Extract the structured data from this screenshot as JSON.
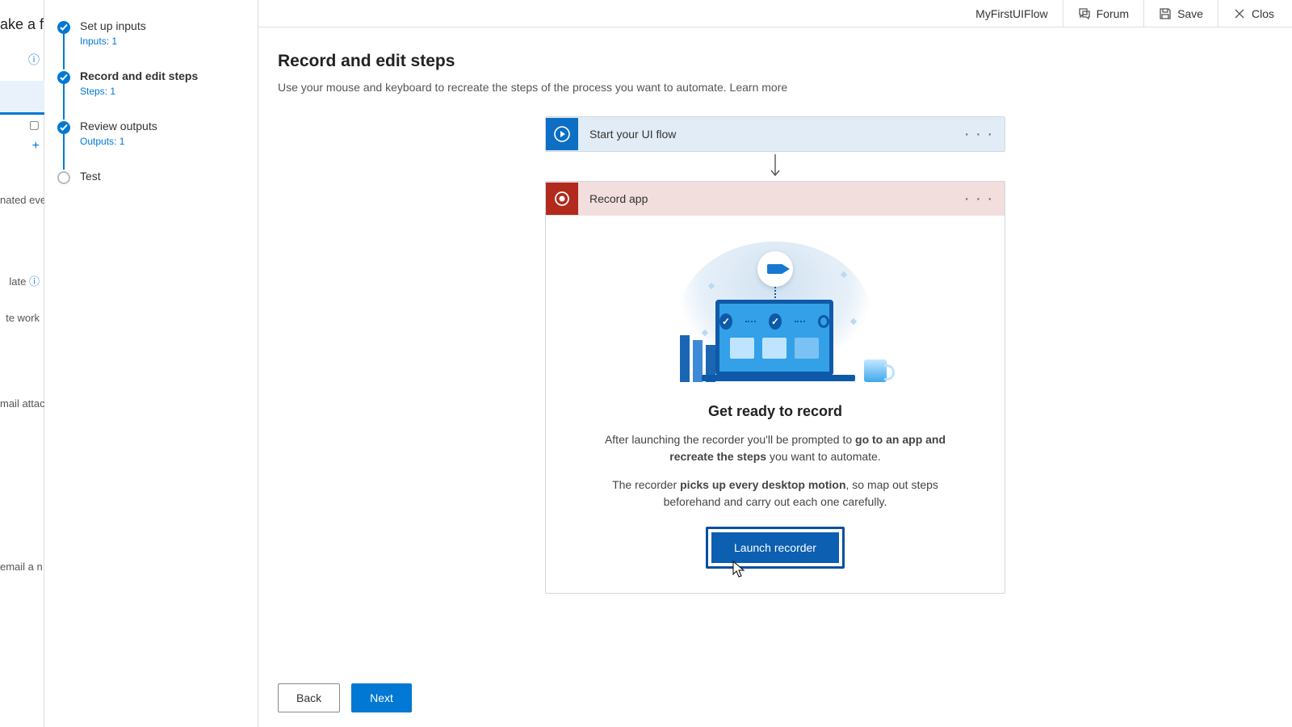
{
  "leftcol": {
    "title_frag": "ake a fl",
    "frag1": "nated even",
    "frag2": "late",
    "frag3": "te work",
    "frag4": "mail attac",
    "frag5": "email a n"
  },
  "steps": [
    {
      "label": "Set up inputs",
      "sub": "Inputs: 1",
      "done": true,
      "active": false
    },
    {
      "label": "Record and edit steps",
      "sub": "Steps: 1",
      "done": true,
      "active": true
    },
    {
      "label": "Review outputs",
      "sub": "Outputs: 1",
      "done": true,
      "active": false
    },
    {
      "label": "Test",
      "sub": "",
      "done": false,
      "active": false
    }
  ],
  "topbar": {
    "flow_name": "MyFirstUIFlow",
    "forum": "Forum",
    "save": "Save",
    "close": "Clos"
  },
  "page": {
    "heading": "Record and edit steps",
    "desc_text": "Use your mouse and keyboard to recreate the steps of the process you want to automate.  ",
    "learn_more": "Learn more"
  },
  "cards": {
    "start_title": "Start your UI flow",
    "record_title": "Record app"
  },
  "record_panel": {
    "heading": "Get ready to record",
    "p1_pre": "After launching the recorder you'll be prompted to ",
    "p1_bold": "go to an app and recreate the steps",
    "p1_post": " you want to automate.",
    "p2_pre": "The recorder ",
    "p2_bold": "picks up every desktop motion",
    "p2_post": ", so map out steps beforehand and carry out each one carefully.",
    "launch_label": "Launch recorder"
  },
  "footer": {
    "back": "Back",
    "next": "Next"
  }
}
